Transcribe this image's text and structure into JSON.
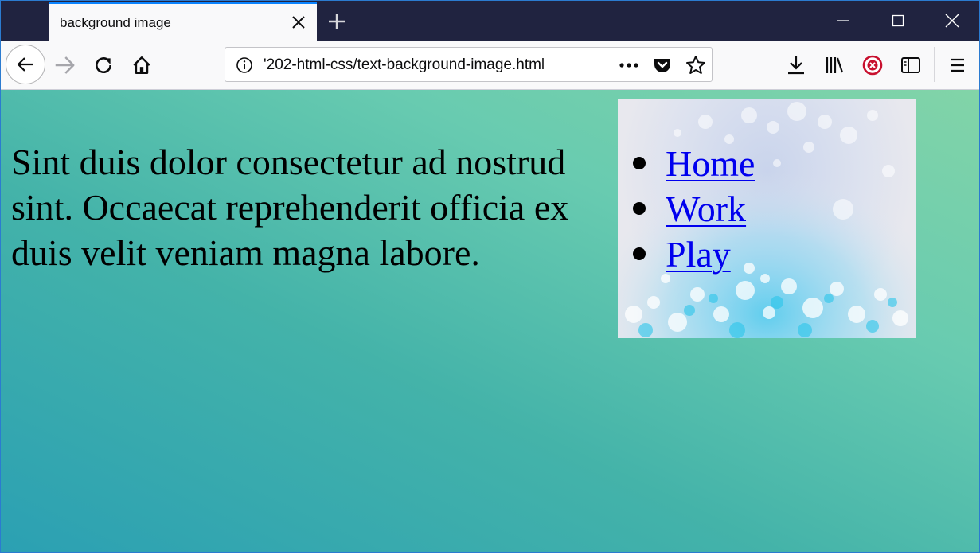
{
  "browser": {
    "tab": {
      "title": "background image"
    },
    "url": "'202-html-css/text-background-image.html",
    "icons": {
      "back": "back-arrow-icon",
      "forward": "forward-arrow-icon",
      "reload": "reload-icon",
      "home": "home-icon",
      "info": "info-icon",
      "more": "page-actions-icon",
      "pocket": "pocket-icon",
      "bookmark": "star-icon",
      "downloads": "download-icon",
      "library": "library-icon",
      "blocker": "blocker-icon",
      "sidebar": "sidebar-icon",
      "menu": "hamburger-menu-icon"
    },
    "accent": "#0a84ff"
  },
  "page": {
    "paragraph": "Sint duis dolor consectetur ad nostrud sint. Occaecat reprehenderit officia ex duis velit veniam magna labore.",
    "nav": [
      {
        "label": "Home"
      },
      {
        "label": "Work"
      },
      {
        "label": "Play"
      }
    ],
    "link_color": "#0000ee"
  }
}
